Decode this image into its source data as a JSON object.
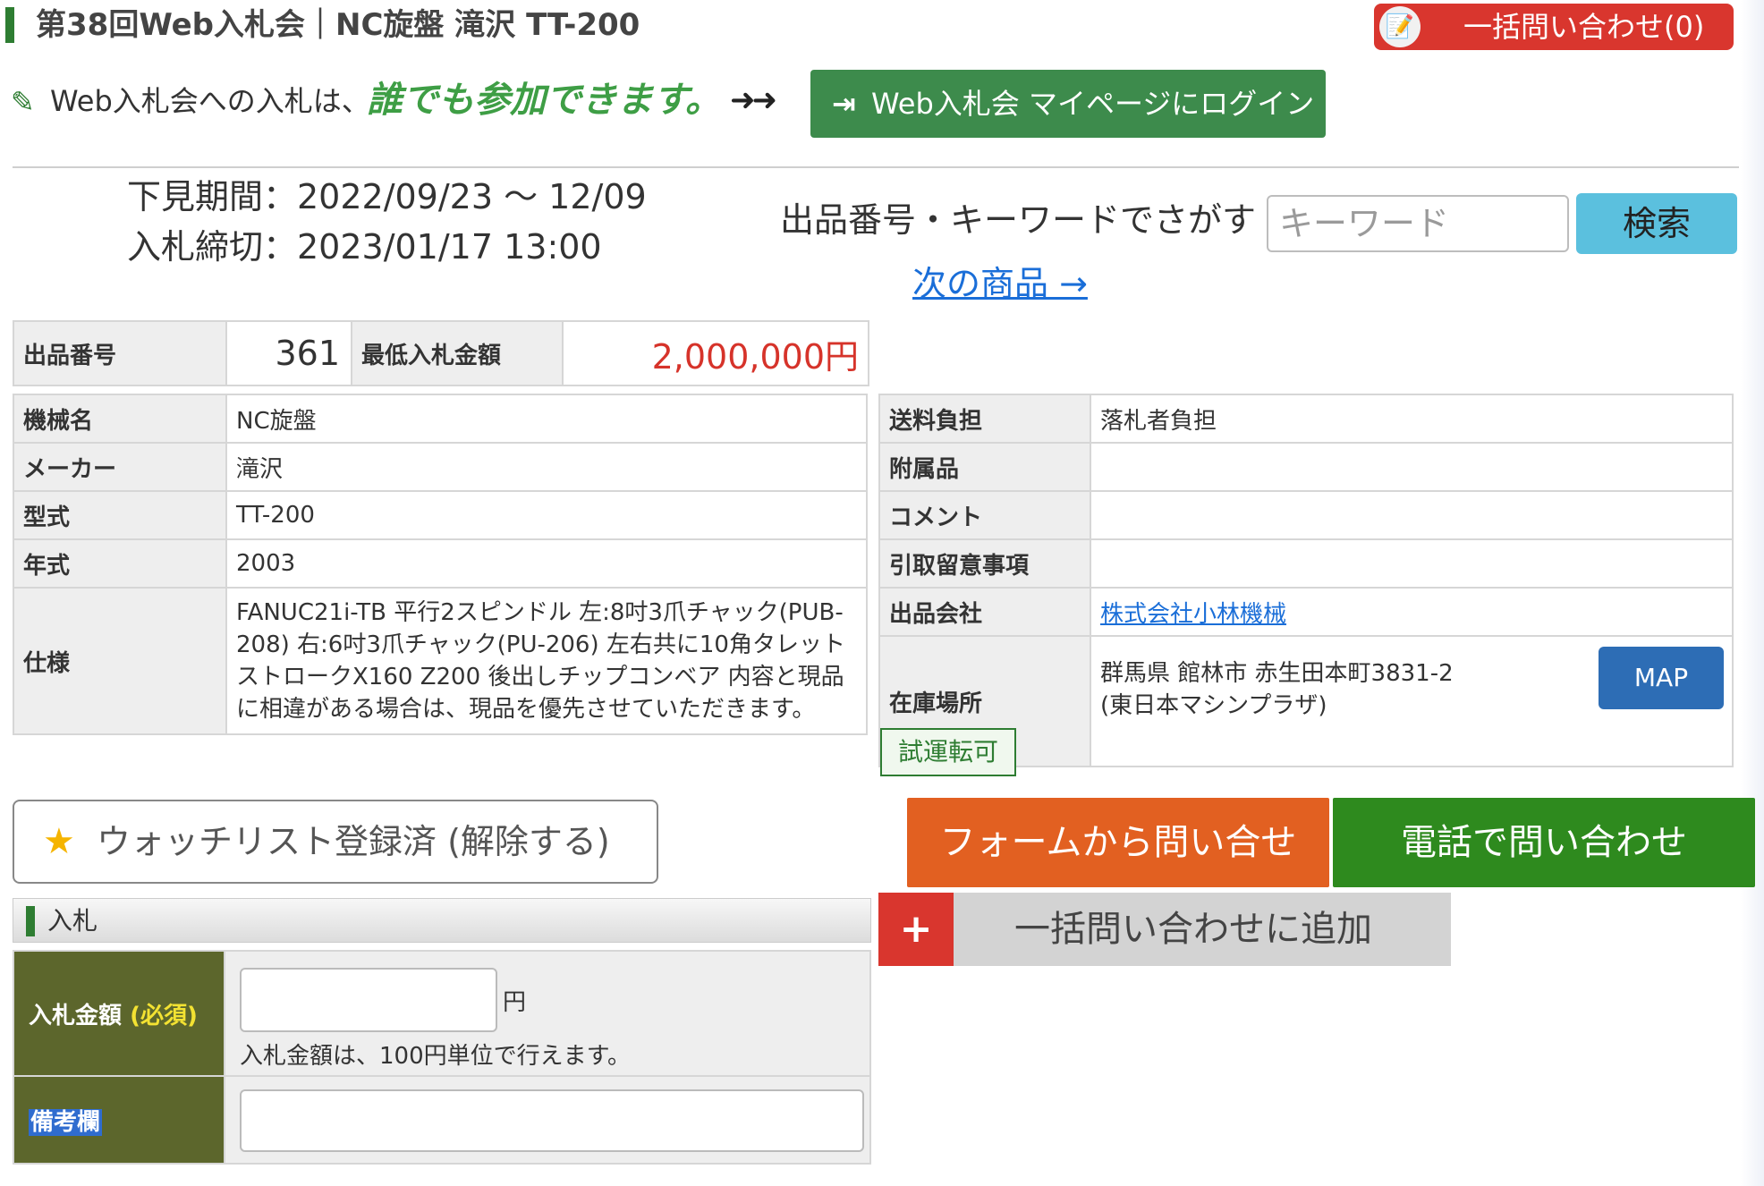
{
  "header": {
    "title": "第38回Web入札会｜NC旋盤 滝沢 TT-200",
    "bulk_inquiry": "一括問い合わせ(0)"
  },
  "notice": {
    "text": "Web入札会への入札は、",
    "emphasis": "誰でも参加できます。",
    "arrows": "➜➜",
    "mypage_button": "Web入札会 マイページにログイン"
  },
  "period": {
    "preview": "下見期間：2022/09/23 〜 12/09",
    "deadline": "入札締切：2023/01/17 13:00"
  },
  "search": {
    "label": "出品番号・キーワードでさがす",
    "placeholder": "キーワード",
    "button": "検索",
    "next_link": "次の商品 →"
  },
  "lot": {
    "number_label": "出品番号",
    "number": "361",
    "min_price_label": "最低入札金額",
    "min_price": "2,000,000円"
  },
  "spec": [
    {
      "label": "機械名",
      "value": "NC旋盤"
    },
    {
      "label": "メーカー",
      "value": "滝沢"
    },
    {
      "label": "型式",
      "value": "TT-200"
    },
    {
      "label": "年式",
      "value": "2003"
    },
    {
      "label": "仕様",
      "value": "FANUC21i-TB 平行2スピンドル 左:8吋3爪チャック(PUB-208) 右:6吋3爪チャック(PU-206) 左右共に10角タレット ストロークX160 Z200 後出しチップコンベア 内容と現品に相違がある場合は、現品を優先させていただきます。"
    }
  ],
  "info": {
    "shipping_label": "送料負担",
    "shipping": "落札者負担",
    "accessories_label": "附属品",
    "accessories": "",
    "comment_label": "コメント",
    "comment": "",
    "pickup_label": "引取留意事項",
    "pickup": "",
    "company_label": "出品会社",
    "company": "株式会社小林機械",
    "location_label": "在庫場所",
    "location_line1": "群馬県 館林市 赤生田本町3831-2",
    "location_line2": "(東日本マシンプラザ)",
    "map_button": "MAP"
  },
  "badge": "試運転可",
  "watchlist": "ウォッチリスト登録済 (解除する)",
  "inquiry": {
    "form": "フォームから問い合せ",
    "phone": "電話で問い合わせ",
    "add_bulk": "一括問い合わせに追加",
    "plus": "+"
  },
  "bid": {
    "section_title": "入札",
    "amount_label": "入札金額",
    "required": "(必須)",
    "yen": "円",
    "hint": "入札金額は、100円単位で行えます。",
    "remarks_label": "備考欄"
  },
  "colors": {
    "brand_green": "#2e7d32",
    "price_red": "#d6332a",
    "link_blue": "#1a6ed8",
    "form_orange": "#e26021",
    "phone_green": "#2e8a1e",
    "bid_header_olive": "#5c662c"
  }
}
